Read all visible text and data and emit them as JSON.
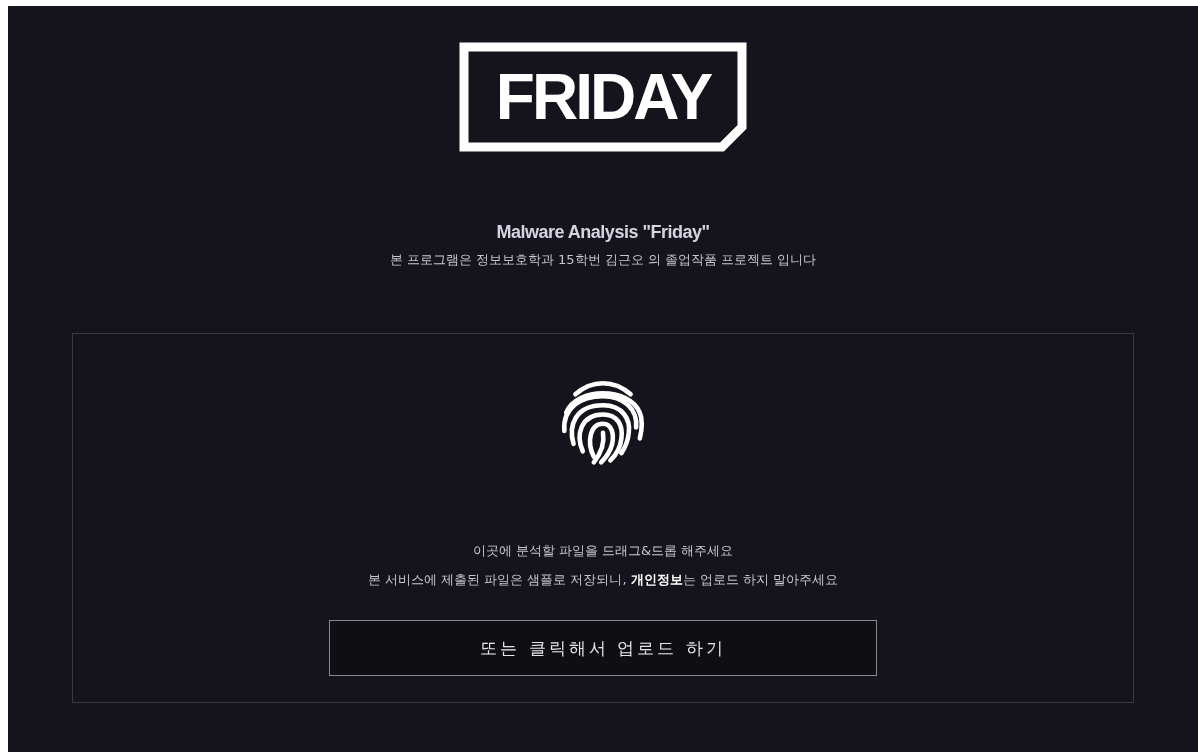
{
  "logo": {
    "text": "FRIDAY"
  },
  "header": {
    "title": "Malware Analysis \"Friday\"",
    "subtitle": "본 프로그램은 정보보호학과 15학번 김근오 의 졸업작품 프로젝트 입니다"
  },
  "dropzone": {
    "instruction": "이곳에 분석할 파일을 드래그&드롭 해주세요",
    "notice": "본 서비스에 제출된 파일은 샘플로 저장되니, **개인정보**는 업로드 하지 말아주세요",
    "button": "또는 클릭해서 업로드 하기"
  }
}
